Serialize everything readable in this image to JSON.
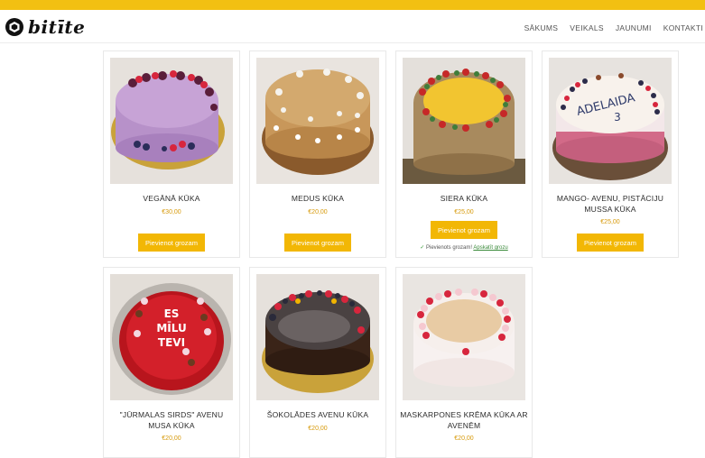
{
  "brand": {
    "name": "bitīte",
    "logo_icon": "bee-hexagon-icon"
  },
  "nav": [
    {
      "label": "SĀKUMS"
    },
    {
      "label": "VEIKALS"
    },
    {
      "label": "JAUNUMI"
    },
    {
      "label": "KONTAKTI"
    }
  ],
  "colors": {
    "accent": "#f2b705",
    "topbar": "#f2c012",
    "price": "#d79a0b"
  },
  "products": [
    {
      "name": "VEGĀNĀ KŪKA",
      "price": "€30,00",
      "button": "Pievienot grozam"
    },
    {
      "name": "MEDUS KŪKA",
      "price": "€20,00",
      "button": "Pievienot grozam"
    },
    {
      "name": "SIERA KŪKA",
      "price": "€25,00",
      "button": "Pievienot grozam",
      "added_text": "Pievienots grozam!",
      "view_cart": "Apskatīt grozu"
    },
    {
      "name": "MANGO- AVENU, PISTĀCIJU MUSSA KŪKA",
      "price": "€25,00",
      "button": "Pievienot grozam"
    },
    {
      "name": "\"JŪRMALAS SIRDS\" AVENU MUSA KŪKA",
      "price": "€20,00"
    },
    {
      "name": "ŠOKOLĀDES AVENU KŪKA",
      "price": "€20,00"
    },
    {
      "name": "MASKARPONES KRĒMA KŪKA AR AVENĒM",
      "price": "€20,00"
    }
  ],
  "cake_texts": {
    "adelaida": "ADELAIDA",
    "adelaida_num": "3",
    "es": "ES",
    "milu": "MĪLU",
    "tevi": "TEVI"
  }
}
